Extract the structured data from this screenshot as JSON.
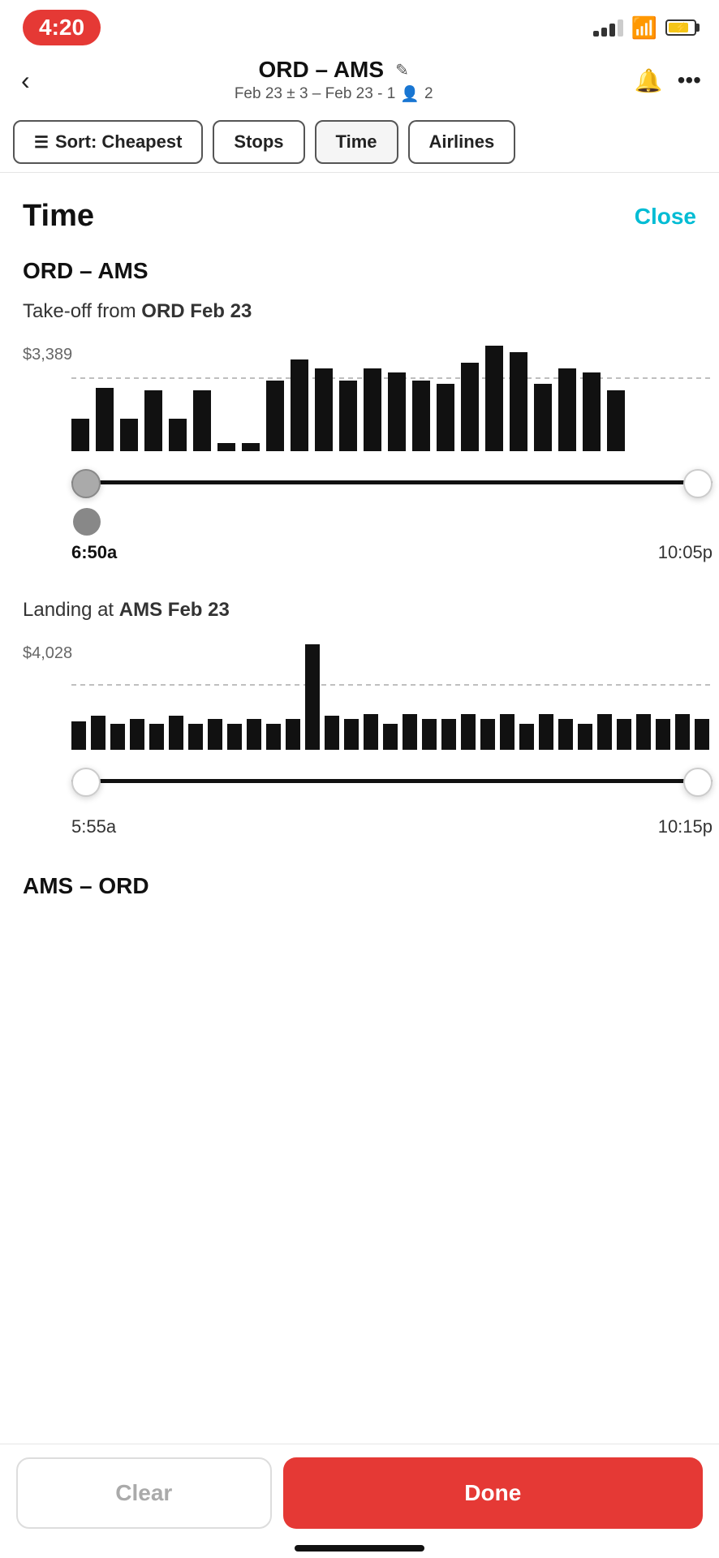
{
  "statusBar": {
    "time": "4:20",
    "batteryCharging": true
  },
  "header": {
    "title": "ORD – AMS",
    "editIcon": "✎",
    "subtitle": "Feb 23 ± 3 – Feb 23 - 1",
    "passengers": "2",
    "backLabel": "‹"
  },
  "filterTabs": [
    {
      "id": "sort",
      "icon": "☰",
      "label": "Sort: Cheapest"
    },
    {
      "id": "stops",
      "label": "Stops"
    },
    {
      "id": "time",
      "label": "Time"
    },
    {
      "id": "airlines",
      "label": "Airlines"
    }
  ],
  "panel": {
    "title": "Time",
    "closeLabel": "Close",
    "sections": [
      {
        "id": "outbound",
        "route": "ORD – AMS",
        "takeoffLabel": "Take-off from",
        "takeoffLocation": "ORD Feb 23",
        "priceLabel": "$3,389",
        "timeStart": "6:50a",
        "timeEnd": "10:05p",
        "leftThumbActive": true,
        "bars": [
          5,
          9,
          5,
          8,
          5,
          8,
          0,
          0,
          12,
          16,
          14,
          10,
          14,
          13,
          12,
          11,
          15,
          21,
          18,
          11,
          14,
          13,
          9
        ]
      },
      {
        "id": "landing",
        "landingLabel": "Landing at",
        "landingLocation": "AMS Feb 23",
        "priceLabel": "$4,028",
        "timeStart": "5:55a",
        "timeEnd": "10:15p",
        "leftThumbActive": false,
        "bars": [
          4,
          5,
          3,
          4,
          3,
          5,
          3,
          4,
          3,
          4,
          3,
          4,
          24,
          6,
          4,
          5,
          3,
          5,
          4,
          4,
          5,
          4,
          5,
          4,
          5,
          3,
          5,
          4,
          4,
          5,
          4,
          5
        ]
      }
    ],
    "returnSection": {
      "route": "AMS – ORD"
    }
  },
  "bottomBar": {
    "clearLabel": "Clear",
    "doneLabel": "Done"
  }
}
